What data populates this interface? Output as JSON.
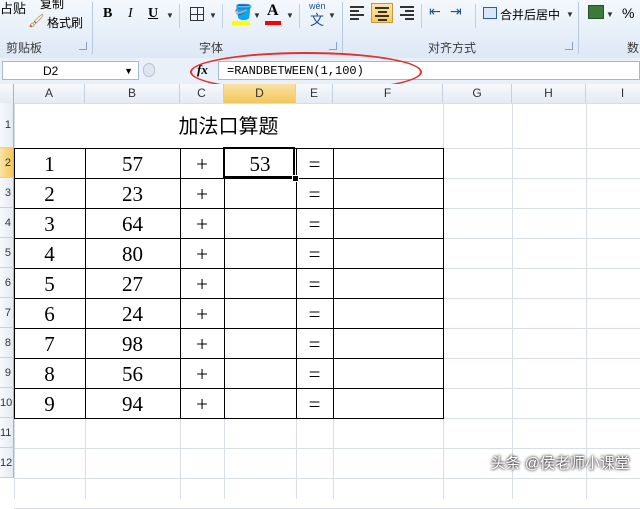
{
  "ribbon": {
    "clipboard": {
      "paste_label": "占贴",
      "copy_label": "复制",
      "format_painter_label": "格式刷",
      "group_label": "剪贴板"
    },
    "font": {
      "bold": "B",
      "italic": "I",
      "underline": "U",
      "fill_color": "#ffff00",
      "font_color": "#ff0000",
      "phonetic": "wén",
      "group_label": "字体"
    },
    "alignment": {
      "merge_label": "合并后居中",
      "group_label": "对齐方式"
    },
    "number": {
      "percent": "%",
      "group_label": "数"
    }
  },
  "formula_bar": {
    "name_box": "D2",
    "fx_label": "fx",
    "formula": "=RANDBETWEEN(1,100)",
    "highlight_color": "#e03030"
  },
  "columns": [
    "A",
    "B",
    "C",
    "D",
    "E",
    "F",
    "G",
    "H",
    "I"
  ],
  "rows": [
    "1",
    "2",
    "3",
    "4",
    "5",
    "6",
    "7",
    "8",
    "9",
    "10",
    "11",
    "12"
  ],
  "sheet": {
    "title": "加法口算题",
    "plus": "+",
    "equals": "=",
    "rows": [
      {
        "n": "1",
        "a": "57",
        "d": "53"
      },
      {
        "n": "2",
        "a": "23",
        "d": ""
      },
      {
        "n": "3",
        "a": "64",
        "d": ""
      },
      {
        "n": "4",
        "a": "80",
        "d": ""
      },
      {
        "n": "5",
        "a": "27",
        "d": ""
      },
      {
        "n": "6",
        "a": "24",
        "d": ""
      },
      {
        "n": "7",
        "a": "98",
        "d": ""
      },
      {
        "n": "8",
        "a": "56",
        "d": ""
      },
      {
        "n": "9",
        "a": "94",
        "d": ""
      }
    ]
  },
  "watermark": "头条 @侯老师小课堂"
}
